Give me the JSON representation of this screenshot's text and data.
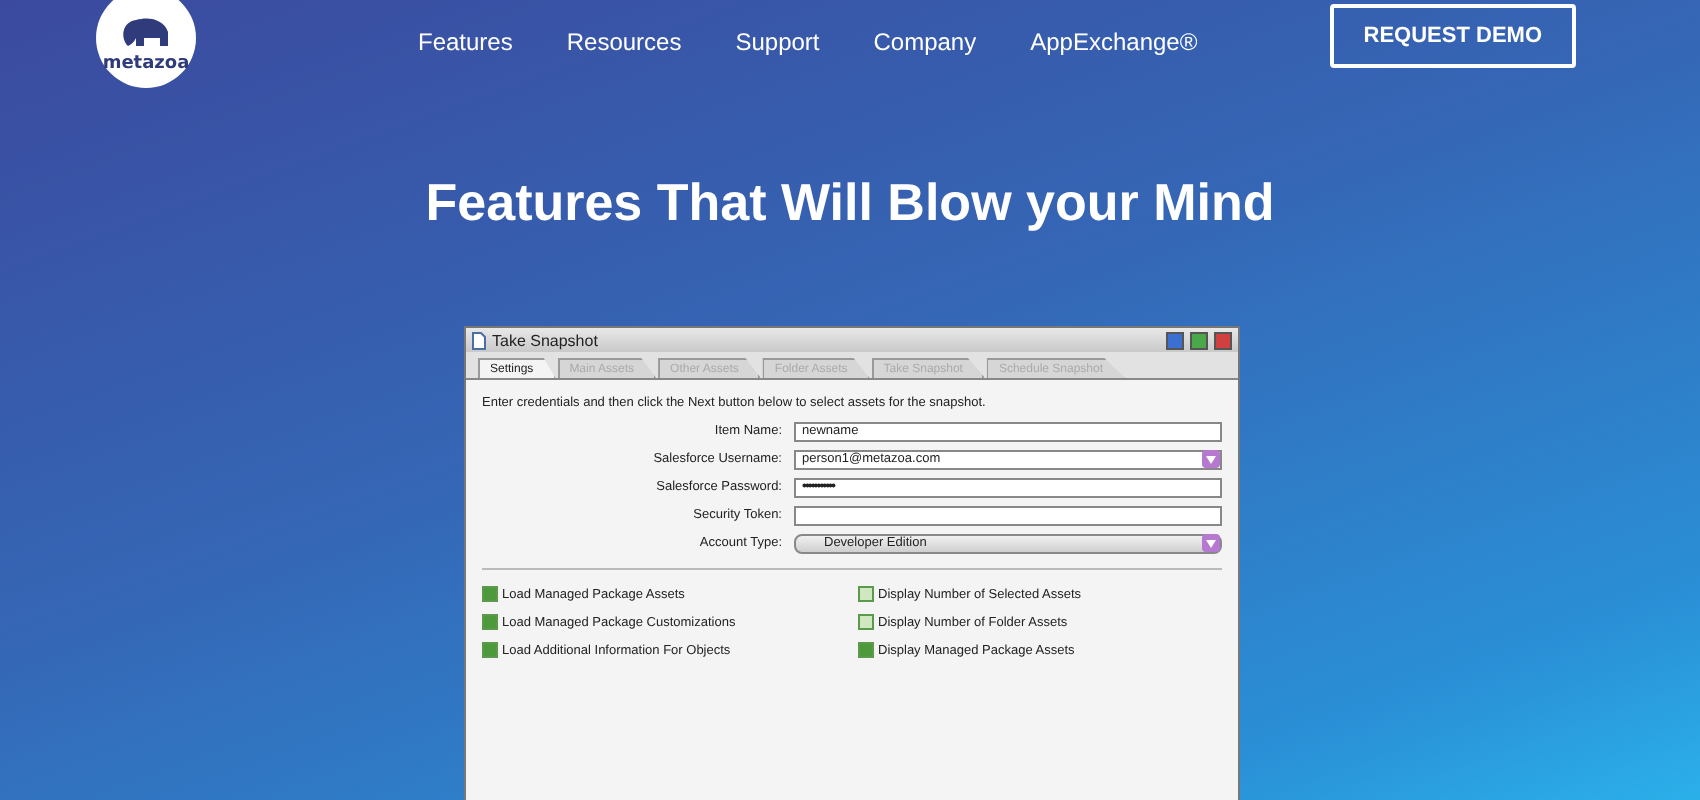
{
  "header": {
    "logo": "metazoa",
    "nav": [
      {
        "label": "Features"
      },
      {
        "label": "Resources"
      },
      {
        "label": "Support"
      },
      {
        "label": "Company"
      },
      {
        "label": "AppExchange®"
      }
    ],
    "cta": "REQUEST DEMO"
  },
  "hero": {
    "title": "Features That Will Blow your Mind"
  },
  "window": {
    "title": "Take Snapshot",
    "tabs": [
      {
        "label": "Settings",
        "selected": true
      },
      {
        "label": "Main Assets",
        "selected": false
      },
      {
        "label": "Other Assets",
        "selected": false
      },
      {
        "label": "Folder Assets",
        "selected": false
      },
      {
        "label": "Take Snapshot",
        "selected": false
      },
      {
        "label": "Schedule Snapshot",
        "selected": false
      }
    ],
    "instructions": "Enter credentials and then click the Next button below to select assets for the snapshot.",
    "fields": [
      {
        "label": "Item Name:",
        "kind": "text",
        "value": "newname"
      },
      {
        "label": "Salesforce Username:",
        "kind": "combo",
        "value": "person1@metazoa.com"
      },
      {
        "label": "Salesforce Password:",
        "kind": "password",
        "value": "•••••••••••"
      },
      {
        "label": "Security Token:",
        "kind": "text"
      },
      {
        "label": "Account Type:",
        "kind": "select",
        "value": "Developer Edition"
      }
    ],
    "options": [
      {
        "label": "Load Managed Package Assets",
        "checked": true
      },
      {
        "label": "Display Number of Selected Assets",
        "checked": false
      },
      {
        "label": "Load Managed Package Customizations",
        "checked": true
      },
      {
        "label": "Display Number of Folder Assets",
        "checked": false
      },
      {
        "label": "Load Additional Information For Objects",
        "checked": true
      },
      {
        "label": "Display Managed Package Assets",
        "checked": true
      }
    ]
  }
}
